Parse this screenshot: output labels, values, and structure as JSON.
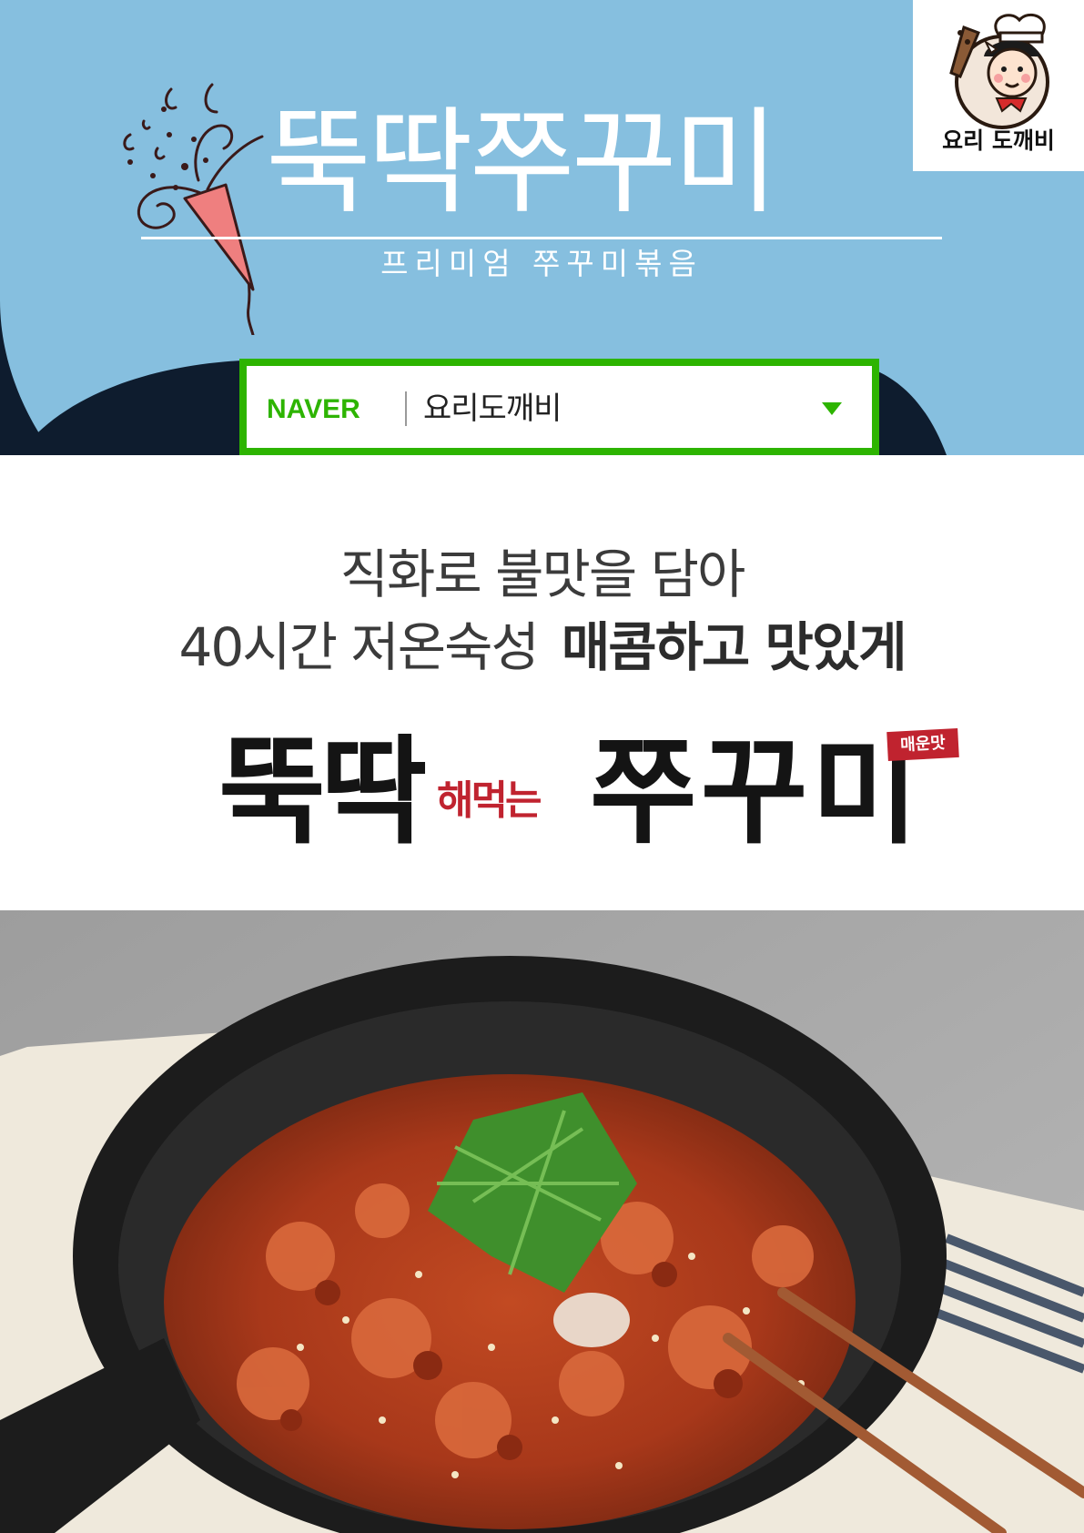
{
  "header": {
    "title": "뚝딱쭈꾸미",
    "subtitle": "프리미엄 쭈꾸미볶음",
    "logo": {
      "icon": "goblin-chef-mascot-icon",
      "caption": "요리 도깨비"
    }
  },
  "search": {
    "brand": "NAVER",
    "query": "요리도깨비",
    "dropdown_icon": "dropdown-triangle-icon"
  },
  "headline": {
    "line1": "직화로 불맛을 담아",
    "line2_plain": "40시간 저온숙성",
    "line2_bold": "매콤하고 맛있게"
  },
  "brand_mark": {
    "part1": "뚝딱",
    "part2": "해먹는",
    "part3": "쭈꾸미",
    "badge": "매운맛"
  },
  "photo": {
    "subject": "spicy-stir-fried-webfoot-octopus-in-cast-iron-pan"
  },
  "colors": {
    "banner_blue": "#86bfdf",
    "banner_dark": "#0e1c2e",
    "naver_green": "#2db400",
    "accent_red": "#c0232f"
  }
}
